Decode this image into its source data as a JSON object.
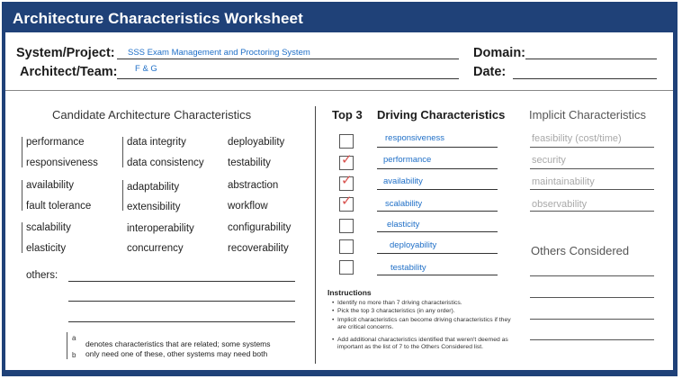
{
  "title": "Architecture Characteristics Worksheet",
  "header": {
    "system_label": "System/Project:",
    "system_value": "SSS Exam Management and Proctoring System",
    "architect_label": "Architect/Team:",
    "architect_value": "F & G",
    "domain_label": "Domain:",
    "domain_value": "",
    "date_label": "Date:",
    "date_value": ""
  },
  "candidate": {
    "heading": "Candidate Architecture Characteristics",
    "col1": [
      "performance",
      "responsiveness",
      "availability",
      "fault tolerance",
      "scalability",
      "elasticity"
    ],
    "col2": [
      "data integrity",
      "data consistency",
      "adaptability",
      "extensibility",
      "interoperability",
      "concurrency"
    ],
    "col3": [
      "deployability",
      "testability",
      "abstraction",
      "workflow",
      "configurability",
      "recoverability"
    ],
    "others_label": "others:"
  },
  "top3_heading": "Top 3",
  "driving": {
    "heading": "Driving Characteristics",
    "items": [
      {
        "label": "responsiveness",
        "top3": false
      },
      {
        "label": "performance",
        "top3": true
      },
      {
        "label": "availability",
        "top3": true
      },
      {
        "label": "scalability",
        "top3": true
      },
      {
        "label": "elasticity",
        "top3": false
      },
      {
        "label": "deployability",
        "top3": false
      },
      {
        "label": "testability",
        "top3": false
      }
    ],
    "check_glyph": "✓"
  },
  "implicit": {
    "heading": "Implicit Characteristics",
    "items": [
      "feasibility (cost/time)",
      "security",
      "maintainability",
      "observability"
    ],
    "others_heading": "Others Considered"
  },
  "instructions": {
    "title": "Instructions",
    "items": [
      "Identify no more than 7 driving characteristics.",
      "Pick the top 3 characteristics (in any order).",
      "Implicit characteristics can become driving characteristics if they are critical concerns.",
      "Add additional characteristics identified that weren't deemed as important as the list of 7 to the Others Considered list."
    ]
  },
  "legend": {
    "letter_a": "a",
    "letter_b": "b",
    "line1": "denotes characteristics that are related; some systems",
    "line2": "only need one of these, other systems may need both"
  },
  "colors": {
    "brand": "#1f4178",
    "value": "#1f6fc7",
    "check": "#d9534f",
    "implicit": "#a9a9a9"
  }
}
